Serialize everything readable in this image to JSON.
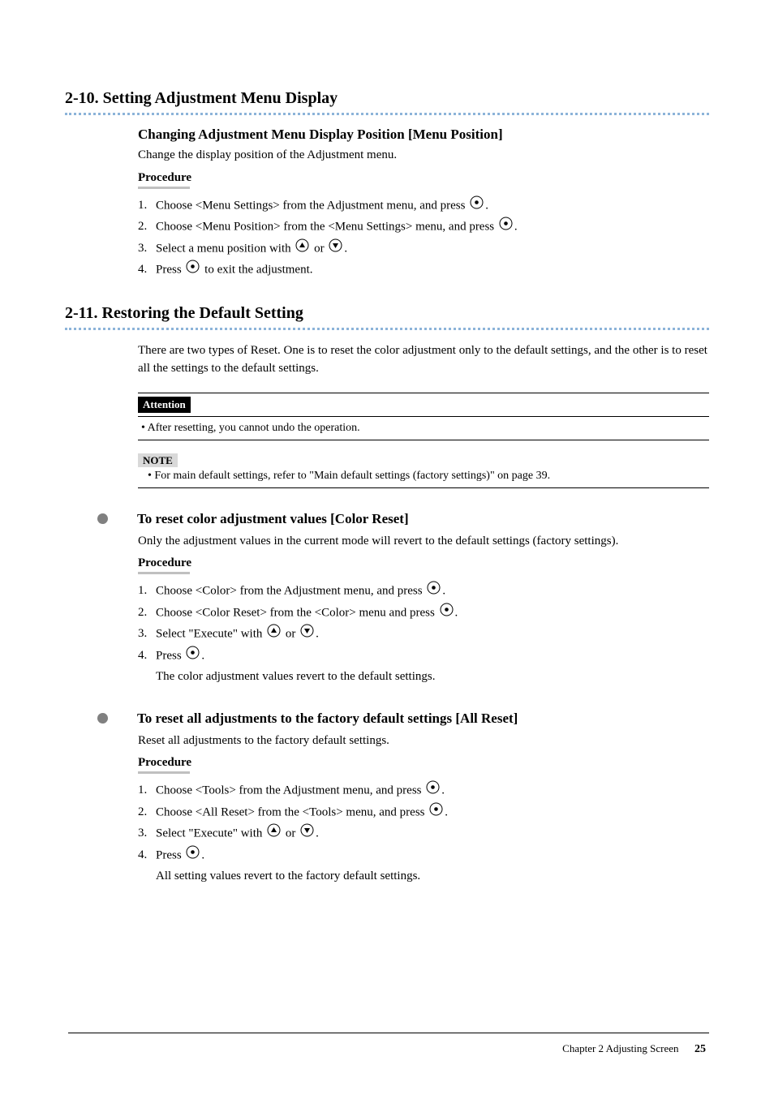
{
  "section1": {
    "heading": "2-10. Setting Adjustment Menu Display",
    "sub_heading": "Changing Adjustment Menu Display Position [Menu Position]",
    "sub_para": "Change the display position of the Adjustment menu.",
    "procedure_label": "Procedure",
    "step1_num": "1.",
    "step1_a": "Choose <Menu Settings> from the Adjustment menu, and press ",
    "step1_a_end": ".",
    "step2_num": "2.",
    "step2": "Choose <Menu Position> from the <Menu Settings> menu, and press ",
    "step2_end": ".",
    "step3_num": "3.",
    "step3_a": "Select a menu position with ",
    "step3_mid": " or ",
    "step3_end": ".",
    "step4_num": "4.",
    "step4_a": "Press ",
    "step4_b": " to exit the adjustment."
  },
  "section2": {
    "heading": "2-11. Restoring the Default Setting",
    "intro_a": "There are two types of Reset. One is to reset the color adjustment only to the default settings, and the other is to reset all the settings to the default settings.",
    "attention_label": "Attention",
    "attention_body": "• After resetting, you cannot undo the operation.",
    "note_label": "NOTE",
    "note_body_a": "• For main default settings, refer to \"Main default settings (factory settings)\" on ",
    "note_body_link": "page 39",
    "note_body_b": ".",
    "bullet1_heading": "To reset color adjustment values [Color Reset]",
    "bullet1_para": "Only the adjustment values in the current mode will revert to the default settings (factory settings).",
    "procedure_label": "Procedure",
    "b1_step1_num": "1.",
    "b1_step1": "Choose <Color> from the Adjustment menu, and press ",
    "b1_step1_end": ".",
    "b1_step2_num": "2.",
    "b1_step2": "Choose <Color Reset> from the <Color> menu and press ",
    "b1_step2_end": ".",
    "b1_step3_num": "3.",
    "b1_step3_a": "Select \"Execute\" with ",
    "b1_step3_mid": " or ",
    "b1_step3_end": ".",
    "b1_step4_num": "4.",
    "b1_step4_a": "Press ",
    "b1_step4_b": ".",
    "b1_step4_c": "The color adjustment values revert to the default settings.",
    "bullet2_heading": "To reset all adjustments to the factory default settings [All Reset]",
    "bullet2_para": "Reset all adjustments to the factory default settings.",
    "b2_step1_num": "1.",
    "b2_step1": "Choose <Tools> from the Adjustment menu, and press ",
    "b2_step1_end": ".",
    "b2_step2_num": "2.",
    "b2_step2": "Choose <All Reset> from the <Tools> menu, and press ",
    "b2_step2_end": ".",
    "b2_step3_num": "3.",
    "b2_step3_a": "Select \"Execute\" with ",
    "b2_step3_mid": " or ",
    "b2_step3_end": ".",
    "b2_step4_num": "4.",
    "b2_step4_a": "Press ",
    "b2_step4_b": ".",
    "b2_step4_c": "All setting values revert to the factory default settings."
  },
  "footer": {
    "chapter": "Chapter 2  Adjusting Screen",
    "page": "25"
  }
}
